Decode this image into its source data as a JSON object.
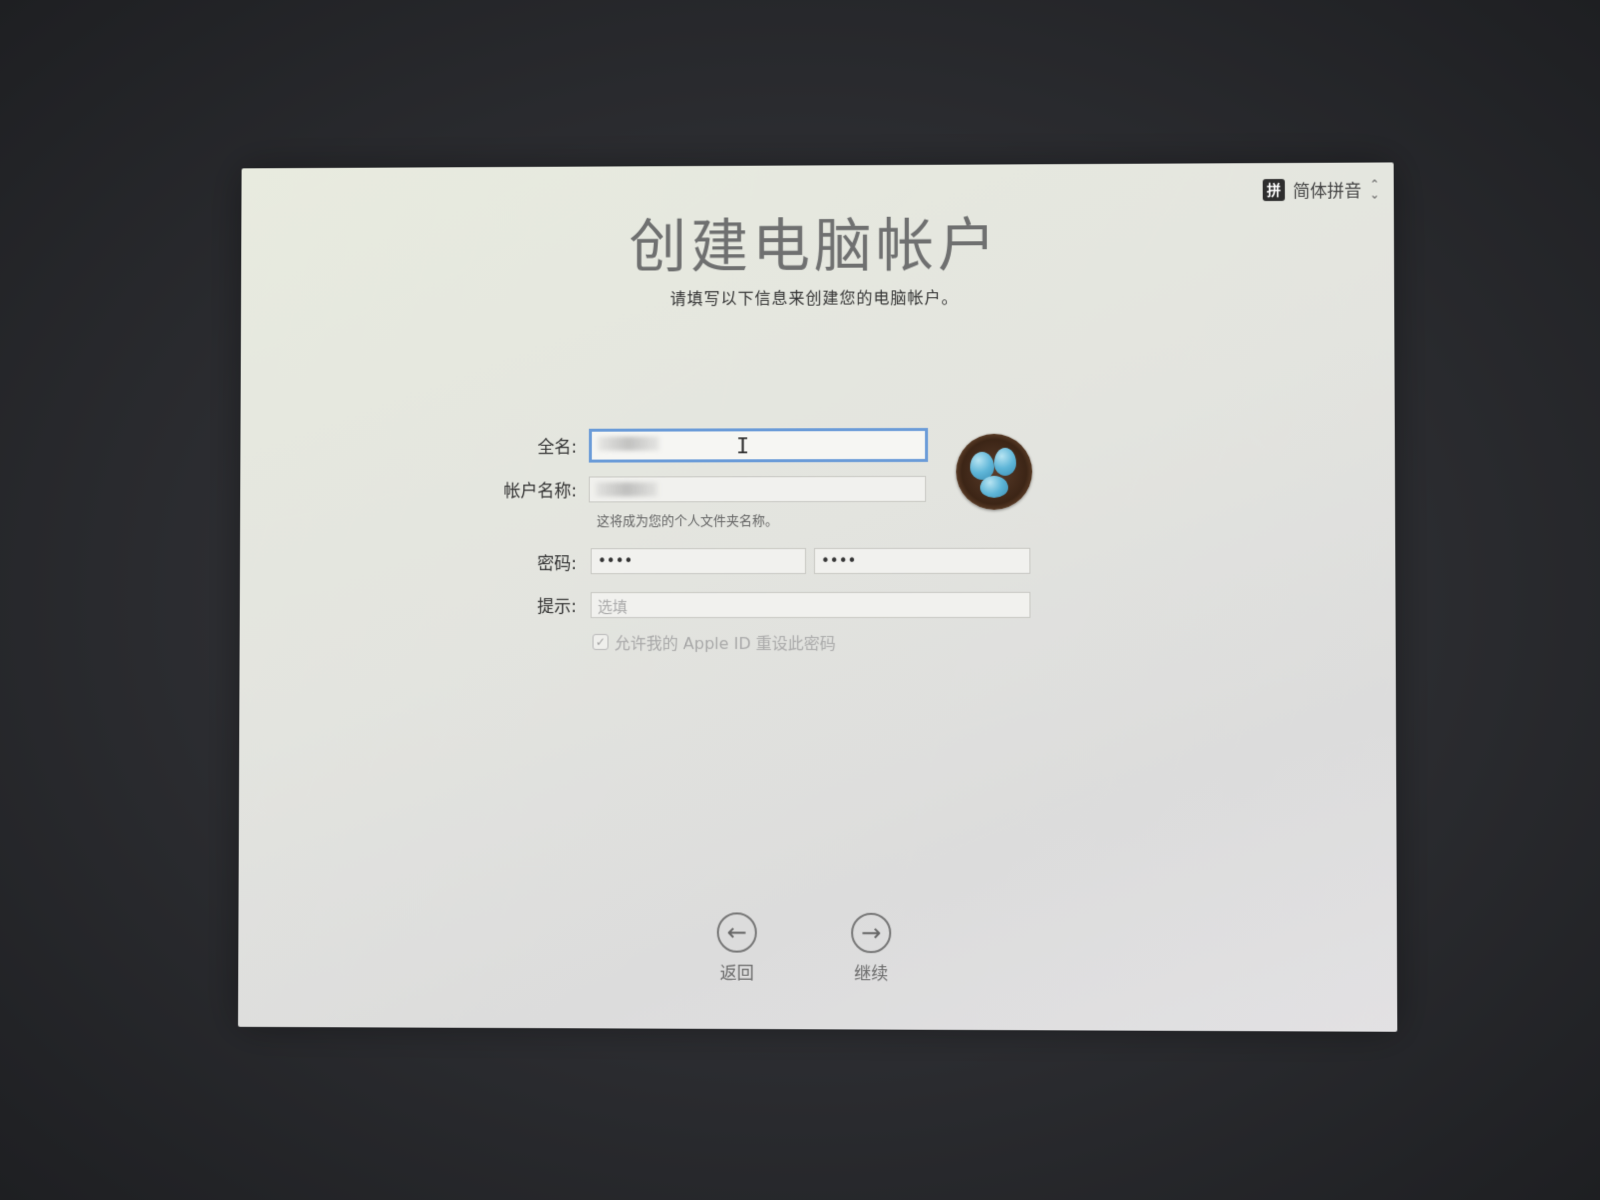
{
  "input_source": {
    "icon_glyph": "拼",
    "icon": "pinyin-input-icon",
    "label": "简体拼音"
  },
  "title": "创建电脑帐户",
  "subtitle": "请填写以下信息来创建您的电脑帐户。",
  "form": {
    "full_name_label": "全名:",
    "full_name_value": "",
    "account_name_label": "帐户名称:",
    "account_name_value": "",
    "account_name_helper": "这将成为您的个人文件夹名称。",
    "password_label": "密码:",
    "password_value": "••••",
    "verify_value": "••••",
    "hint_label": "提示:",
    "hint_placeholder": "选填",
    "allow_apple_id_reset": {
      "checked": true,
      "label": "允许我的 Apple ID 重设此密码"
    }
  },
  "avatar": {
    "icon": "bird-nest-eggs-icon"
  },
  "navigation": {
    "back_label": "返回",
    "continue_label": "继续"
  },
  "colors": {
    "focus_ring": "#6a9bd8",
    "egg_blue": "#5fb6d8"
  }
}
